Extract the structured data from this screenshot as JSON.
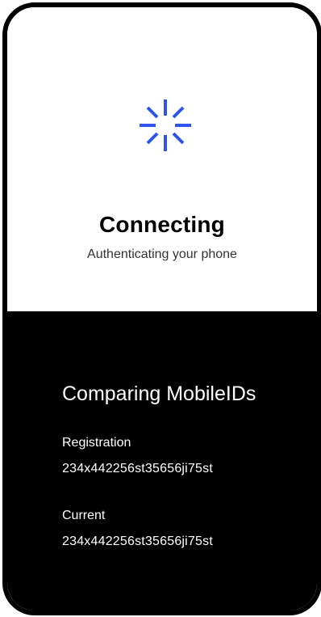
{
  "status": {
    "title": "Connecting",
    "subtitle": "Authenticating your phone",
    "spinner_color": "#2f54eb",
    "spinner_icon": "loading-spinner-icon"
  },
  "comparison": {
    "title": "Comparing MobileIDs",
    "registration": {
      "label": "Registration",
      "value": "234x442256st35656ji75st"
    },
    "current": {
      "label": "Current",
      "value": "234x442256st35656ji75st"
    }
  }
}
